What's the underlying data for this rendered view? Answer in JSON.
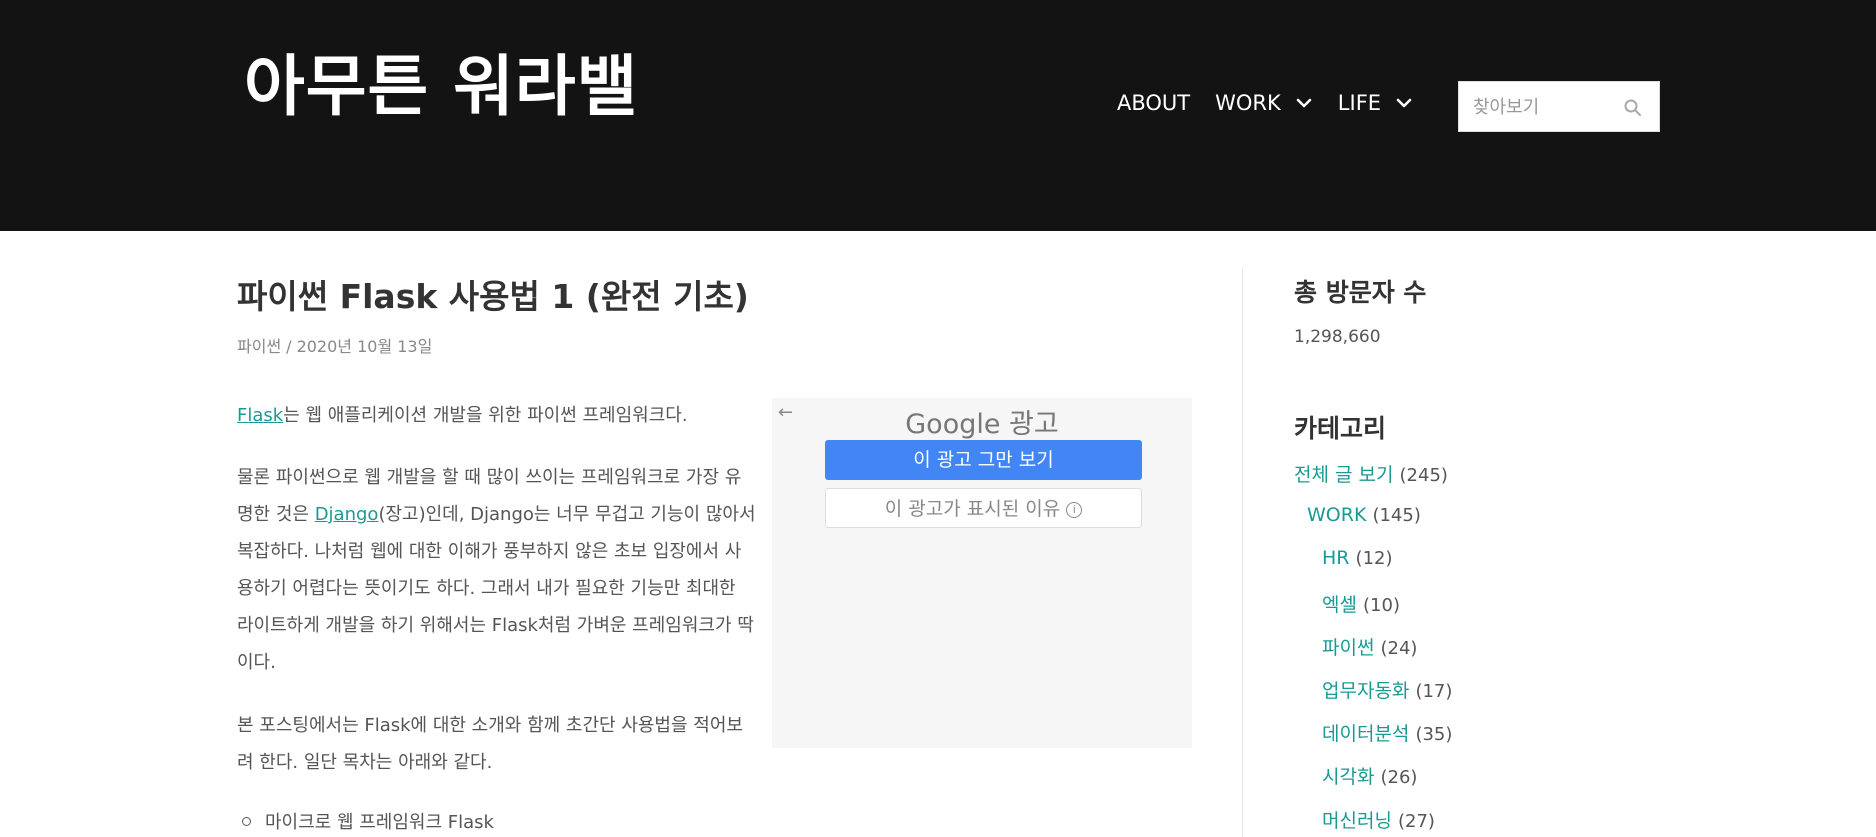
{
  "site": {
    "title": "아무튼 워라밸"
  },
  "nav": {
    "items": [
      {
        "label": "ABOUT",
        "has_dropdown": false
      },
      {
        "label": "WORK",
        "has_dropdown": true
      },
      {
        "label": "LIFE",
        "has_dropdown": true
      }
    ],
    "search_placeholder": "찾아보기"
  },
  "post": {
    "title": "파이썬 Flask 사용법 1 (완전 기초)",
    "category": "파이썬",
    "separator": "/",
    "date": "2020년 10월 13일",
    "p1_link": "Flask",
    "p1_text": "는 웹 애플리케이션 개발을 위한 파이썬 프레임워크다.",
    "p2_a": "물론 파이썬으로 웹 개발을 할 때 많이 쓰이는 프레임워크로 가장 유명한 것은 ",
    "p2_link": "Django",
    "p2_b": "(장고)인데, Django는 너무 무겁고 기능이 많아서 복잡하다. 나처럼 웹에 대한 이해가 풍부하지 않은 초보 입장에서 사용하기 어렵다는 뜻이기도 하다. 그래서 내가 필요한 기능만 최대한 라이트하게 개발을 하기 위해서는 Flask처럼 가벼운 프레임워크가 딱이다.",
    "p3": "본 포스팅에서는 Flask에 대한 소개와 함께 초간단 사용법을 적어보려 한다. 일단 목차는 아래와 같다.",
    "toc_first": "마이크로 웹 프레임워크 Flask"
  },
  "ad": {
    "back": "←",
    "brand": "Google 광고",
    "stop_label": "이 광고 그만 보기",
    "why_label": "이 광고가 표시된 이유",
    "info": "i"
  },
  "sidebar": {
    "visitors_title": "총 방문자 수",
    "visitors_count": "1,298,660",
    "categories_title": "카테고리",
    "categories": [
      {
        "label": "전체 글 보기",
        "count": "(245)",
        "level": 0
      },
      {
        "label": "WORK",
        "count": "(145)",
        "level": 1
      },
      {
        "label": "HR",
        "count": "(12)",
        "level": 2
      },
      {
        "label": "엑셀",
        "count": "(10)",
        "level": 2
      },
      {
        "label": "파이썬",
        "count": "(24)",
        "level": 2
      },
      {
        "label": "업무자동화",
        "count": "(17)",
        "level": 2
      },
      {
        "label": "데이터분석",
        "count": "(35)",
        "level": 2
      },
      {
        "label": "시각화",
        "count": "(26)",
        "level": 2
      },
      {
        "label": "머신러닝",
        "count": "(27)",
        "level": 2
      }
    ]
  },
  "colors": {
    "header_bg": "#131313",
    "link": "#1a9a94",
    "ad_button": "#4286f5"
  }
}
